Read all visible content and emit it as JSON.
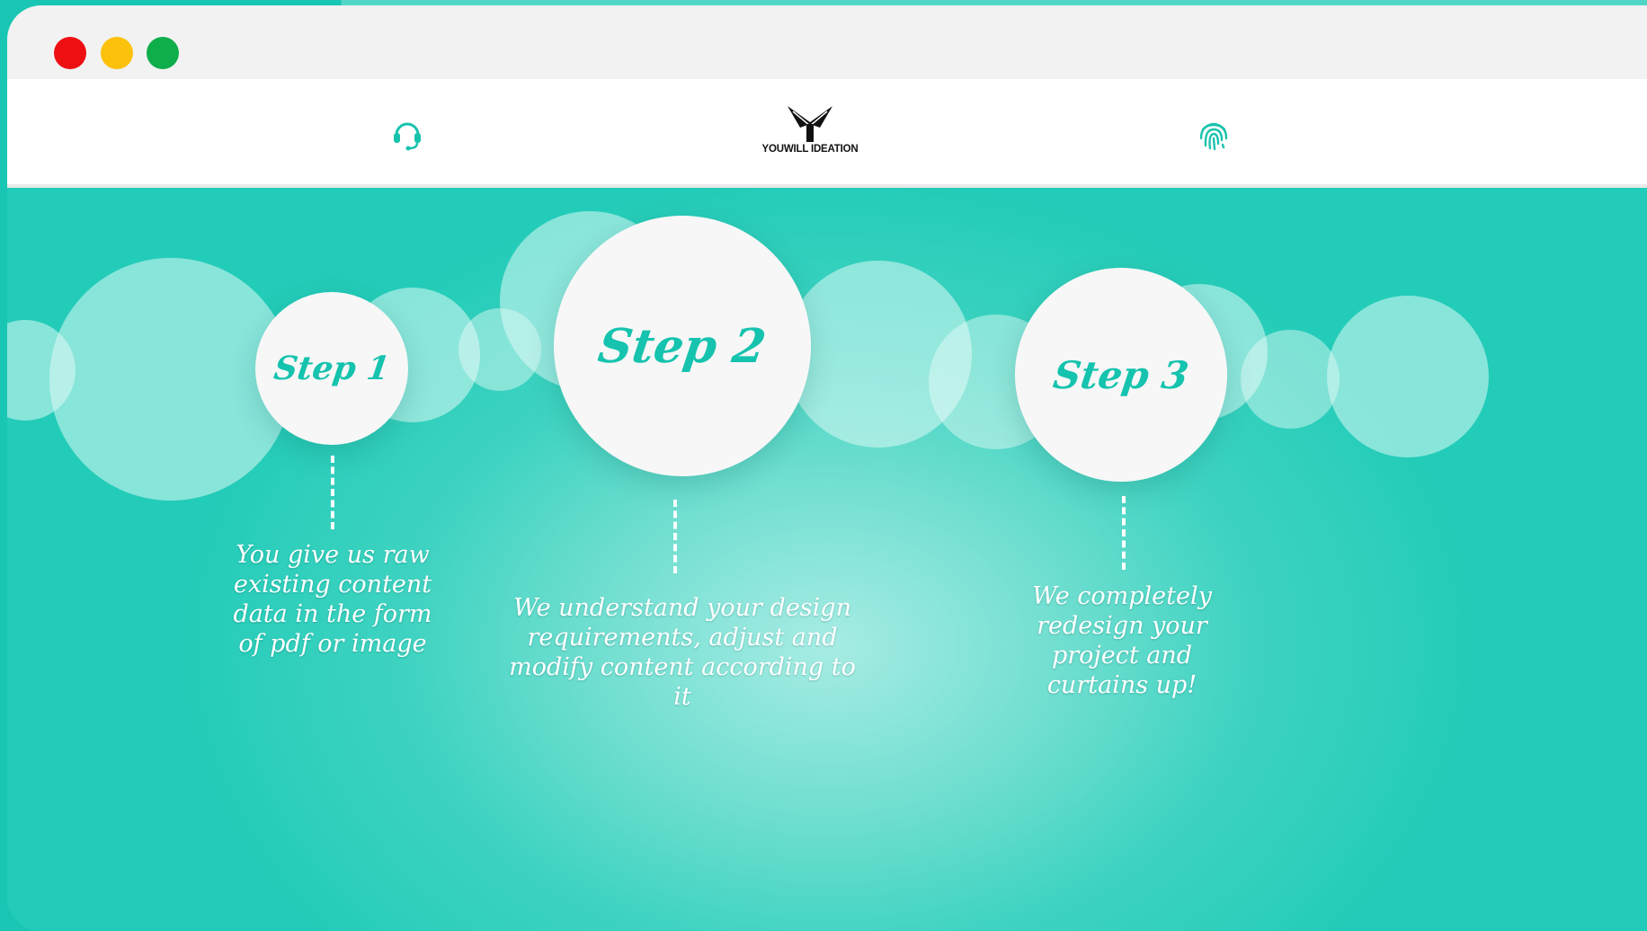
{
  "window": {
    "controls": [
      "close",
      "minimize",
      "maximize"
    ]
  },
  "navbar": {
    "left_icon": "headset-icon",
    "right_icon": "fingerprint-icon",
    "logo_text": "YOUWILL IDEATION"
  },
  "colors": {
    "accent": "#15c3ae",
    "background": "#24cdb9",
    "titlebar": "#f2f2f2"
  },
  "steps": [
    {
      "label": "Step 1",
      "description": "You give us raw existing content data in the form of pdf or image"
    },
    {
      "label": "Step 2",
      "description": "We understand your design requirements, adjust and modify content according to it"
    },
    {
      "label": "Step 3",
      "description": "We completely redesign your project and curtains up!"
    }
  ]
}
